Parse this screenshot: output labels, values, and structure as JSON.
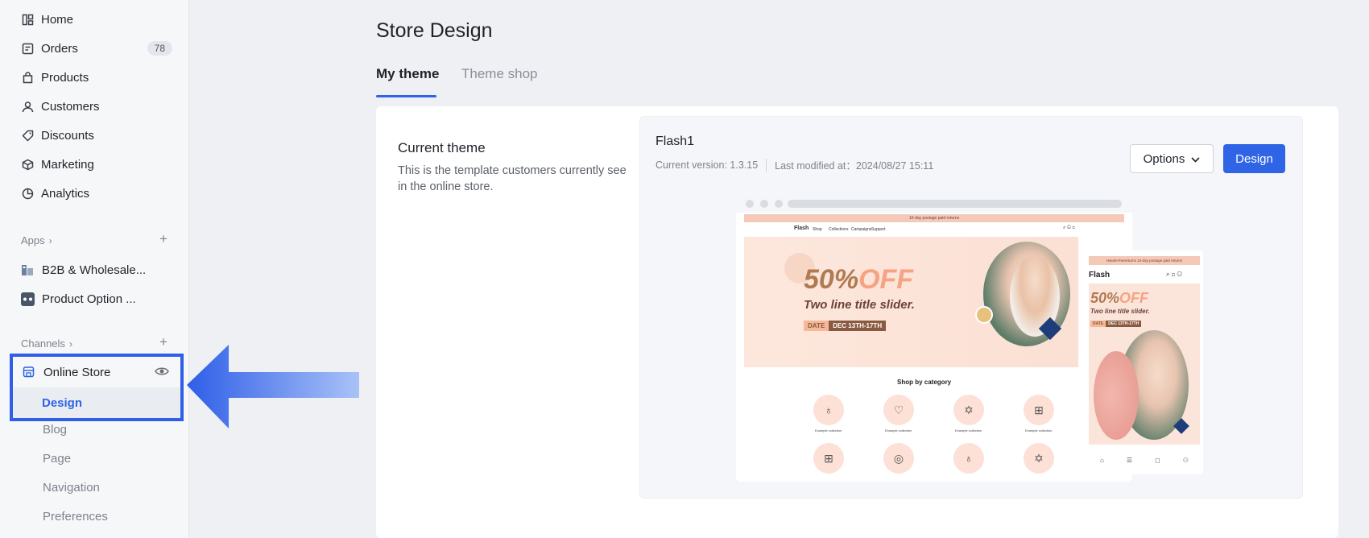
{
  "sidebar": {
    "nav": [
      {
        "label": "Home",
        "icon": "home-icon"
      },
      {
        "label": "Orders",
        "icon": "orders-icon",
        "badge": "78"
      },
      {
        "label": "Products",
        "icon": "products-icon"
      },
      {
        "label": "Customers",
        "icon": "customers-icon"
      },
      {
        "label": "Discounts",
        "icon": "discounts-icon"
      },
      {
        "label": "Marketing",
        "icon": "marketing-icon"
      },
      {
        "label": "Analytics",
        "icon": "analytics-icon"
      }
    ],
    "apps": {
      "label": "Apps",
      "items": [
        {
          "label": "B2B & Wholesale..."
        },
        {
          "label": "Product Option ..."
        }
      ]
    },
    "channels": {
      "label": "Channels",
      "online_store": "Online Store",
      "subitems": [
        "Design",
        "Blog",
        "Page",
        "Navigation",
        "Preferences"
      ]
    }
  },
  "main": {
    "title": "Store Design",
    "tabs": [
      {
        "label": "My theme",
        "active": true
      },
      {
        "label": "Theme shop",
        "active": false
      }
    ],
    "current_theme": {
      "title": "Current theme",
      "description": "This is the template customers currently see in the online store."
    },
    "theme": {
      "name": "Flash1",
      "version": "Current version: 1.3.15",
      "modified": "Last modified at：2024/08/27 15:11",
      "options_label": "Options",
      "design_label": "Design"
    },
    "preview": {
      "announcement": "10-day postage paid returns",
      "mobile_announcement": "Hassle-freereturns 10-day postage paid returns",
      "logo": "Flash",
      "nav_links": [
        "Shop",
        "Collections",
        "Campaigns",
        "Support"
      ],
      "hero_percent": "50%",
      "hero_off": "OFF",
      "hero_subtitle": "Two line title slider.",
      "date_label": "DATE",
      "date_range": "DEC 13TH-17TH",
      "shop_by_category": "Shop by category",
      "category_label": "Example collection"
    }
  },
  "colors": {
    "accent": "#2f64e6",
    "highlight_border": "#2f5ee8",
    "sidebar_bg": "#f6f7f9",
    "page_bg": "#eef0f4"
  }
}
